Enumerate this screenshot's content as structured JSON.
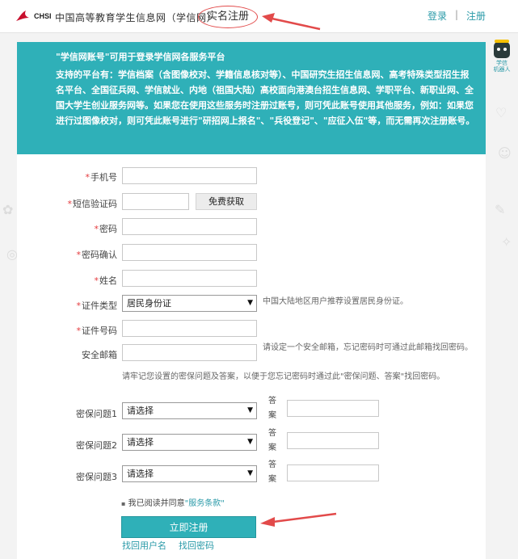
{
  "header": {
    "logo_text": "CHSI",
    "site_name": "中国高等教育学生信息网（学信网）",
    "page_title": "实名注册",
    "login": "登录",
    "separator": "|",
    "register": "注册"
  },
  "assistant": {
    "label_line1": "学信",
    "label_line2": "机器人"
  },
  "banner": {
    "title": "\"学信网账号\"可用于登录学信网各服务平台",
    "body": "支持的平台有：学信档案（含图像校对、学籍信息核对等）、中国研究生招生信息网、高考特殊类型招生报名平台、全国征兵网、学信就业、内地（祖国大陆）高校面向港澳台招生信息网、学职平台、新职业网、全国大学生创业服务网等。如果您在使用这些服务时注册过账号，则可凭此账号使用其他服务，例如：如果您进行过图像校对，则可凭此账号进行\"研招网上报名\"、\"兵役登记\"、\"应征入伍\"等，而无需再次注册账号。"
  },
  "form": {
    "required_mark": "*",
    "mobile": {
      "label": "手机号",
      "value": ""
    },
    "sms_code": {
      "label": "短信验证码",
      "value": "",
      "button": "免费获取"
    },
    "password": {
      "label": "密码",
      "value": ""
    },
    "password_confirm": {
      "label": "密码确认",
      "value": ""
    },
    "name": {
      "label": "姓名",
      "value": ""
    },
    "id_type": {
      "label": "证件类型",
      "selected": "居民身份证",
      "hint": "中国大陆地区用户推荐设置居民身份证。"
    },
    "id_number": {
      "label": "证件号码",
      "value": ""
    },
    "email": {
      "label": "安全邮箱",
      "value": "",
      "hint": "请设定一个安全邮箱，忘记密码时可通过此邮箱找回密码。"
    },
    "security_note": "请牢记您设置的密保问题及答案，以便于您忘记密码时通过此\"密保问题、答案\"找回密码。",
    "questions": [
      {
        "label": "密保问题1",
        "selected": "请选择",
        "answer_label": "答案",
        "answer": ""
      },
      {
        "label": "密保问题2",
        "selected": "请选择",
        "answer_label": "答案",
        "answer": ""
      },
      {
        "label": "密保问题3",
        "selected": "请选择",
        "answer_label": "答案",
        "answer": ""
      }
    ],
    "agree_text": "我已阅读并同意",
    "terms_link": "\"服务条款\"",
    "submit": "立即注册",
    "find_username": "找回用户名",
    "find_password": "找回密码"
  },
  "colors": {
    "accent": "#2fb0b8",
    "link": "#2a9aa8",
    "required": "#e4393c",
    "annotation": "#e24a4a"
  }
}
